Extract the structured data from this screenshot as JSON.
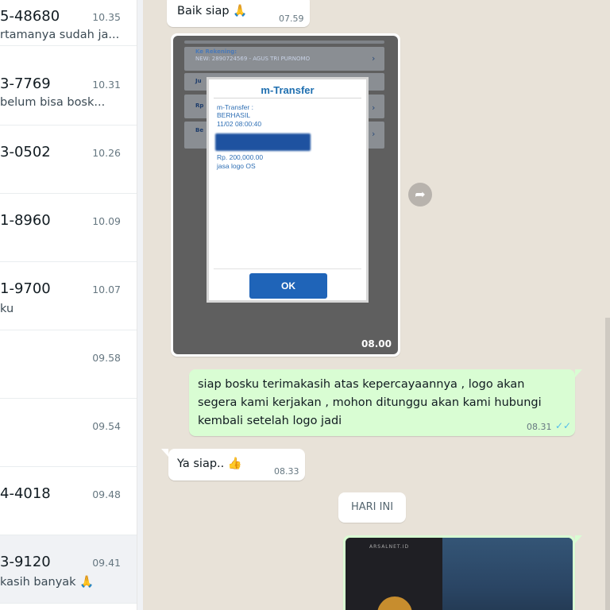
{
  "chat_list": {
    "items": [
      {
        "name": "5-48680",
        "time": "10.35",
        "preview": "rtamanya sudah ja..."
      },
      {
        "name": "3-7769",
        "time": "10.31",
        "preview": " belum bisa bosk..."
      },
      {
        "name": "3-0502",
        "time": "10.26",
        "preview": ""
      },
      {
        "name": "1-8960",
        "time": "10.09",
        "preview": ""
      },
      {
        "name": "1-9700",
        "time": "10.07",
        "preview": "ku"
      },
      {
        "name": "",
        "time": "09.58",
        "preview": ""
      },
      {
        "name": "",
        "time": "09.54",
        "preview": ""
      },
      {
        "name": "4-4018",
        "time": "09.48",
        "preview": ""
      },
      {
        "name": "3-9120",
        "time": "09.41",
        "preview": "kasih  banyak 🙏"
      }
    ]
  },
  "conversation": {
    "msg1": {
      "text": "Baik siap 🙏",
      "time": "07.59"
    },
    "image_msg": {
      "time": "08.00",
      "screenshot": {
        "bg_rows": [
          "Ke Rekening:",
          "NEW: 2890724569 - AGUS TRI PURNOMO",
          "Ju",
          "Rp",
          "Be"
        ],
        "dialog_title": "m-Transfer",
        "dialog_lines": [
          "m-Transfer :",
          "BERHASIL",
          "11/02 08:00:40"
        ],
        "amount": "Rp. 200,000.00",
        "note": "jasa logo OS",
        "ok_label": "OK"
      }
    },
    "forward_icon": "forward-arrow-icon",
    "msg2": {
      "lines": [
        "siap bosku terimakasih atas kepercayaannya , logo akan",
        "segera kami kerjakan , mohon ditunggu akan kami hubungi",
        "kembali setelah logo jadi"
      ],
      "time": "08.31",
      "ticks": "✓✓"
    },
    "msg3": {
      "text": "Ya siap.. 👍",
      "time": "08.33"
    },
    "date_chip": "HARI INI",
    "image_msg2": {
      "caption": "ARSALNET.ID"
    }
  },
  "colors": {
    "incoming_bubble": "#ffffff",
    "outgoing_bubble": "#d9fdd3",
    "conversation_bg": "#e8e2d8",
    "read_ticks": "#53bdeb"
  }
}
